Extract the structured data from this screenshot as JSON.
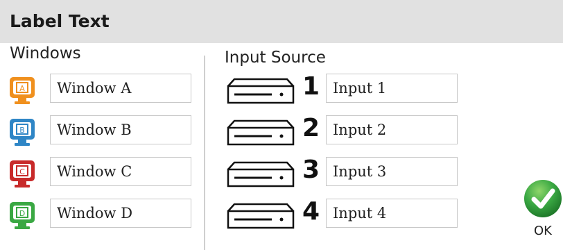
{
  "header": {
    "title": "Label Text"
  },
  "windows": {
    "title": "Windows",
    "items": [
      {
        "icon_letter": "A",
        "value": "Window A",
        "color": "#f0901e",
        "icon": "monitor-icon"
      },
      {
        "icon_letter": "B",
        "value": "Window B",
        "color": "#2f86c6",
        "icon": "monitor-icon"
      },
      {
        "icon_letter": "C",
        "value": "Window C",
        "color": "#c82a2a",
        "icon": "monitor-icon"
      },
      {
        "icon_letter": "D",
        "value": "Window D",
        "color": "#3aa843",
        "icon": "monitor-icon"
      }
    ]
  },
  "input_source": {
    "title": "Input Source",
    "items": [
      {
        "number": "1",
        "value": "Input 1",
        "icon": "input-device-icon"
      },
      {
        "number": "2",
        "value": "Input 2",
        "icon": "input-device-icon"
      },
      {
        "number": "3",
        "value": "Input 3",
        "icon": "input-device-icon"
      },
      {
        "number": "4",
        "value": "Input 4",
        "icon": "input-device-icon"
      }
    ]
  },
  "ok_button": {
    "label": "OK",
    "icon": "checkmark-icon",
    "color": "#3aa843"
  }
}
